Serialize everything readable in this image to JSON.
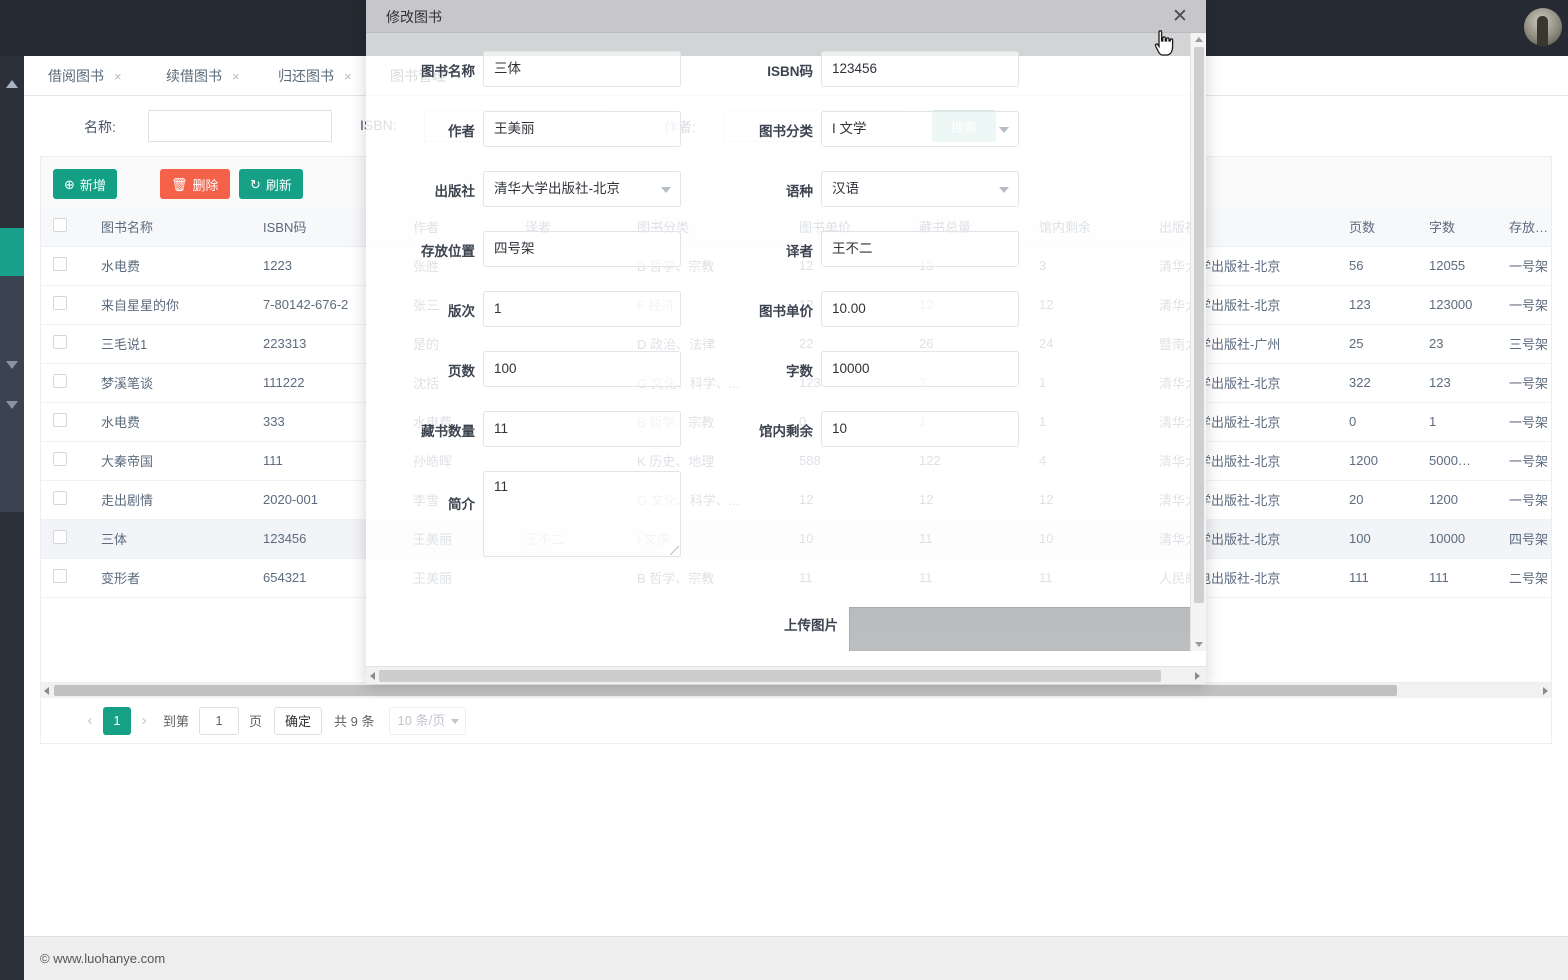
{
  "tabs": [
    {
      "label": "借阅图书",
      "close": "×",
      "active": false
    },
    {
      "label": "续借图书",
      "close": "×",
      "active": false
    },
    {
      "label": "归还图书",
      "close": "×",
      "active": false
    },
    {
      "label": "图书管理",
      "close": "×",
      "active": true
    }
  ],
  "search": {
    "name_label": "名称:",
    "name_value": "",
    "isbn_label": "ISBN:",
    "isbn_value": "",
    "author_label": "作者:",
    "author_value": "",
    "button_label": "搜索"
  },
  "toolbar": {
    "add_label": "新增",
    "add_icon": "⊕",
    "delete_label": "删除",
    "delete_icon": "🗑",
    "refresh_label": "刷新",
    "refresh_icon": "↻"
  },
  "table": {
    "columns": [
      "",
      "图书名称",
      "ISBN码",
      "作者",
      "译者",
      "图书分类",
      "图书单价",
      "藏书总量",
      "馆内剩余",
      "出版社",
      "页数",
      "字数",
      "存放位置"
    ],
    "rows": [
      {
        "selected": false,
        "cells": [
          "",
          "水电费",
          "1223",
          "张胜",
          "",
          "B  哲学、宗教",
          "12",
          "13",
          "3",
          "清华大学出版社-北京",
          "56",
          "12055",
          "一号架"
        ]
      },
      {
        "selected": false,
        "cells": [
          "",
          "来自星星的你",
          "7-80142-676-2",
          "张三",
          "",
          "F  经济",
          "12",
          "12",
          "12",
          "清华大学出版社-北京",
          "123",
          "123000",
          "一号架"
        ]
      },
      {
        "selected": false,
        "cells": [
          "",
          "三毛说1",
          "223313",
          "是的",
          "",
          "D  政治、法律",
          "22",
          "26",
          "24",
          "暨南大学出版社-广州",
          "25",
          "23",
          "三号架"
        ]
      },
      {
        "selected": false,
        "cells": [
          "",
          "梦溪笔谈",
          "111222",
          "沈括",
          "",
          "G  文化、科学、...",
          "123",
          "3",
          "1",
          "清华大学出版社-北京",
          "322",
          "123",
          "一号架"
        ]
      },
      {
        "selected": false,
        "cells": [
          "",
          "水电费",
          "333",
          "水电费",
          "",
          "B  哲学、宗教",
          "0",
          "1",
          "1",
          "清华大学出版社-北京",
          "0",
          "1",
          "一号架"
        ]
      },
      {
        "selected": false,
        "cells": [
          "",
          "大秦帝国",
          "111",
          "孙皓晖",
          "",
          "K  历史、地理",
          "588",
          "122",
          "4",
          "清华大学出版社-北京",
          "1200",
          "5000…",
          "一号架"
        ]
      },
      {
        "selected": false,
        "cells": [
          "",
          "走出剧情",
          "2020-001",
          "李雪",
          "",
          "G  文化、科学、...",
          "12",
          "12",
          "12",
          "清华大学出版社-北京",
          "20",
          "1200",
          "一号架"
        ]
      },
      {
        "selected": true,
        "cells": [
          "",
          "三体",
          "123456",
          "王美丽",
          "王不二",
          "I  文学",
          "10",
          "11",
          "10",
          "清华大学出版社-北京",
          "100",
          "10000",
          "四号架"
        ]
      },
      {
        "selected": false,
        "cells": [
          "",
          "变形者",
          "654321",
          "王美丽",
          "",
          "B  哲学、宗教",
          "11",
          "11",
          "11",
          "人民邮电出版社-北京",
          "111",
          "111",
          "二号架"
        ]
      }
    ]
  },
  "pagination": {
    "prev_icon": "‹",
    "current_page": "1",
    "next_icon": "›",
    "goto_label": "到第",
    "goto_value": "1",
    "page_unit": "页",
    "confirm_label": "确定",
    "total_label": "共 9 条",
    "page_size_label": "10 条/页"
  },
  "footer": {
    "copyright": "© www.luohanye.com"
  },
  "modal": {
    "title": "修改图书",
    "close_icon": "✕",
    "fields": {
      "book_name": {
        "label": "图书名称",
        "value": "三体"
      },
      "isbn": {
        "label": "ISBN码",
        "value": "123456"
      },
      "author": {
        "label": "作者",
        "value": "王美丽"
      },
      "category": {
        "label": "图书分类",
        "value": "I  文学"
      },
      "publisher": {
        "label": "出版社",
        "value": "清华大学出版社-北京"
      },
      "language": {
        "label": "语种",
        "value": "汉语"
      },
      "location": {
        "label": "存放位置",
        "value": "四号架"
      },
      "translator": {
        "label": "译者",
        "value": "王不二"
      },
      "edition": {
        "label": "版次",
        "value": "1"
      },
      "unit_price": {
        "label": "图书单价",
        "value": "10.00"
      },
      "pages": {
        "label": "页数",
        "value": "100"
      },
      "word_count": {
        "label": "字数",
        "value": "10000"
      },
      "stock_total": {
        "label": "藏书数量",
        "value": "11"
      },
      "stock_left": {
        "label": "馆内剩余",
        "value": "10"
      },
      "summary": {
        "label": "简介",
        "value": "11"
      },
      "upload": {
        "label": "上传图片"
      }
    }
  },
  "colors": {
    "accent": "#16a085",
    "danger": "#f56149",
    "sidebar_active": "#17a08b",
    "chrome_dark": "#262b33"
  }
}
